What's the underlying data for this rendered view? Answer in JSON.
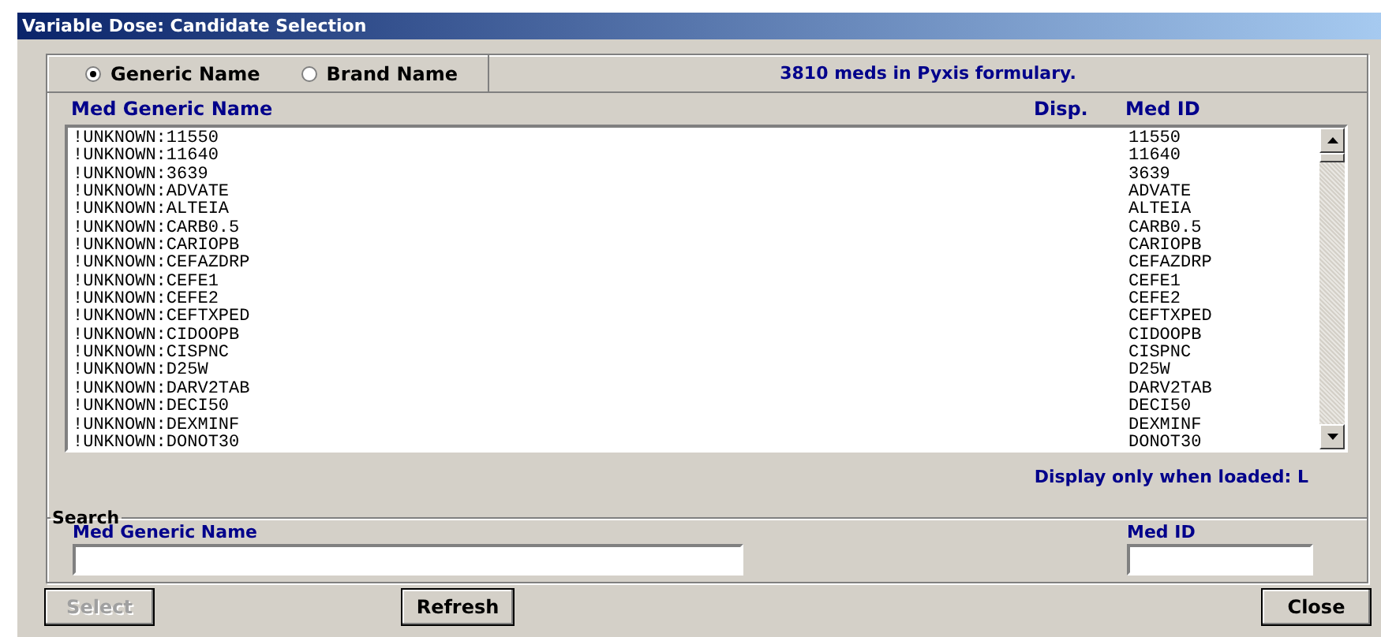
{
  "window": {
    "title": "Variable Dose: Candidate Selection"
  },
  "name_type": [
    {
      "label": "Generic Name",
      "selected": true
    },
    {
      "label": "Brand Name",
      "selected": false
    }
  ],
  "formulary_count": "3810 meds in Pyxis formulary.",
  "table": {
    "columns": [
      "Med Generic Name",
      "Disp.",
      "Med ID"
    ],
    "rows": [
      {
        "name": "!UNKNOWN:11550",
        "med_id": "11550"
      },
      {
        "name": "!UNKNOWN:11640",
        "med_id": "11640"
      },
      {
        "name": "!UNKNOWN:3639",
        "med_id": "3639"
      },
      {
        "name": "!UNKNOWN:ADVATE",
        "med_id": "ADVATE"
      },
      {
        "name": "!UNKNOWN:ALTEIA",
        "med_id": "ALTEIA"
      },
      {
        "name": "!UNKNOWN:CARB0.5",
        "med_id": "CARB0.5"
      },
      {
        "name": "!UNKNOWN:CARIOPB",
        "med_id": "CARIOPB"
      },
      {
        "name": "!UNKNOWN:CEFAZDRP",
        "med_id": "CEFAZDRP"
      },
      {
        "name": "!UNKNOWN:CEFE1",
        "med_id": "CEFE1"
      },
      {
        "name": "!UNKNOWN:CEFE2",
        "med_id": "CEFE2"
      },
      {
        "name": "!UNKNOWN:CEFTXPED",
        "med_id": "CEFTXPED"
      },
      {
        "name": "!UNKNOWN:CIDOOPB",
        "med_id": "CIDOOPB"
      },
      {
        "name": "!UNKNOWN:CISPNC",
        "med_id": "CISPNC"
      },
      {
        "name": "!UNKNOWN:D25W",
        "med_id": "D25W"
      },
      {
        "name": "!UNKNOWN:DARV2TAB",
        "med_id": "DARV2TAB"
      },
      {
        "name": "!UNKNOWN:DECI50",
        "med_id": "DECI50"
      },
      {
        "name": "!UNKNOWN:DEXMINF",
        "med_id": "DEXMINF"
      },
      {
        "name": "!UNKNOWN:DONOT30",
        "med_id": "DONOT30"
      }
    ]
  },
  "display_note": "Display only when loaded: L",
  "search": {
    "title": "Search",
    "fields": [
      {
        "label": "Med Generic Name",
        "kind": "wide"
      },
      {
        "label": "Med ID",
        "kind": "narrow"
      }
    ]
  },
  "buttons": [
    {
      "label": "Select",
      "disabled": true
    },
    {
      "label": "Refresh",
      "disabled": false
    },
    {
      "label": "Close",
      "disabled": false
    }
  ]
}
